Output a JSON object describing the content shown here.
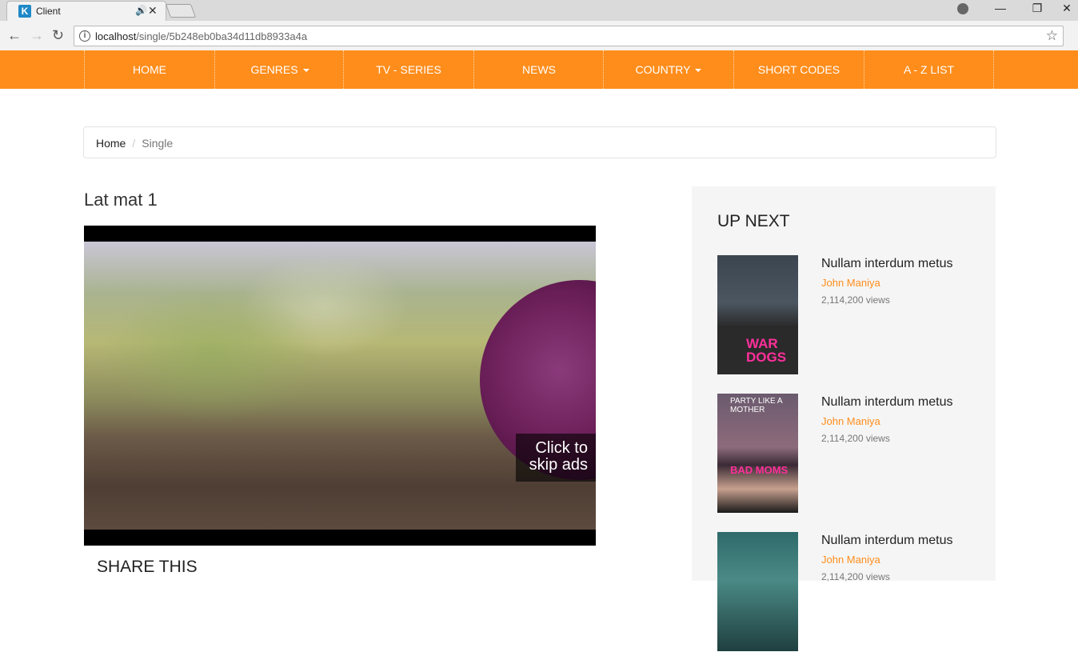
{
  "browser": {
    "tab_title": "Client",
    "tab_favicon": "K",
    "audio_icon": "speaker-icon",
    "url_host": "localhost",
    "url_path": "/single/5b248eb0ba34d11db8933a4a"
  },
  "nav": {
    "items": [
      {
        "label": "HOME",
        "caret": false
      },
      {
        "label": "GENRES",
        "caret": true
      },
      {
        "label": "TV - SERIES",
        "caret": false
      },
      {
        "label": "NEWS",
        "caret": false
      },
      {
        "label": "COUNTRY",
        "caret": true
      },
      {
        "label": "SHORT CODES",
        "caret": false
      },
      {
        "label": "A - Z LIST",
        "caret": false
      }
    ]
  },
  "breadcrumb": {
    "home": "Home",
    "separator": "/",
    "current": "Single"
  },
  "main": {
    "title": "Lat mat 1",
    "skip_ads_line1": "Click to",
    "skip_ads_line2": "skip ads",
    "share_title": "SHARE THIS"
  },
  "sidebar": {
    "title": "UP NEXT",
    "cards": [
      {
        "title": "Nullam interdum metus",
        "author": "John Maniya",
        "views": "2,114,200 views",
        "poster_text": "WAR DOGS"
      },
      {
        "title": "Nullam interdum metus",
        "author": "John Maniya",
        "views": "2,114,200 views",
        "poster_text": "BAD MOMS",
        "poster_top_text": "PARTY LIKE A MOTHER"
      },
      {
        "title": "Nullam interdum metus",
        "author": "John Maniya",
        "views": "2,114,200 views",
        "poster_text": ""
      }
    ]
  },
  "colors": {
    "accent": "#ff8d1b",
    "nav_text": "#ffffff"
  }
}
